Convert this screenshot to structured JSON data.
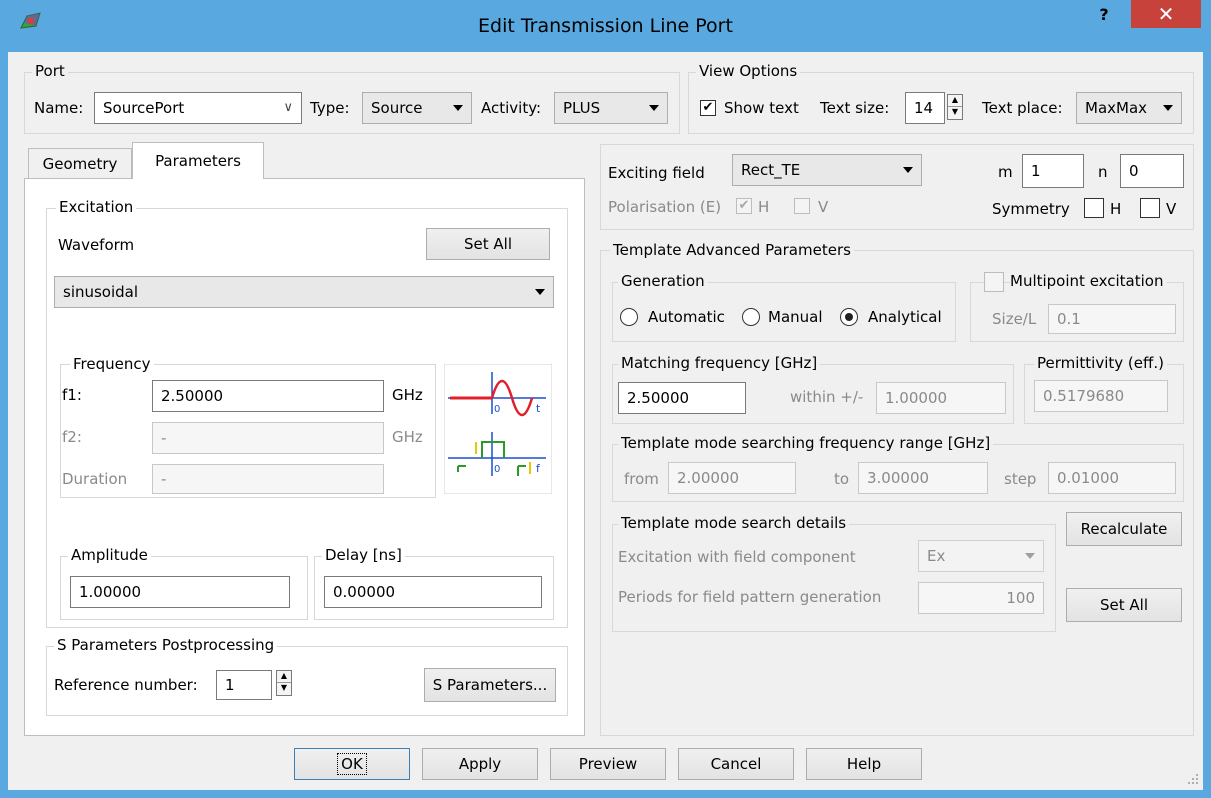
{
  "window": {
    "title": "Edit Transmission Line Port",
    "help_glyph": "?",
    "close_glyph": "✕"
  },
  "port": {
    "group_title": "Port",
    "name_label": "Name:",
    "name_value": "SourcePort",
    "type_label": "Type:",
    "type_value": "Source",
    "activity_label": "Activity:",
    "activity_value": "PLUS"
  },
  "view_options": {
    "group_title": "View Options",
    "show_text_label": "Show text",
    "show_text_checked": true,
    "text_size_label": "Text size:",
    "text_size_value": "14",
    "text_place_label": "Text place:",
    "text_place_value": "MaxMax"
  },
  "tabs": [
    {
      "label": "Geometry",
      "active": false
    },
    {
      "label": "Parameters",
      "active": true
    }
  ],
  "excitation": {
    "group_title": "Excitation",
    "waveform_label": "Waveform",
    "set_all_label": "Set All",
    "waveform_value": "sinusoidal",
    "frequency": {
      "group_title": "Frequency",
      "f1_label": "f1:",
      "f1_value": "2.50000",
      "f1_unit": "GHz",
      "f2_label": "f2:",
      "f2_value": "-",
      "f2_unit": "GHz",
      "duration_label": "Duration",
      "duration_value": "-"
    },
    "amplitude_title": "Amplitude",
    "amplitude_value": "1.00000",
    "delay_title": "Delay [ns]",
    "delay_value": "0.00000"
  },
  "sparams": {
    "group_title": "S Parameters Postprocessing",
    "ref_label": "Reference number:",
    "ref_value": "1",
    "button_label": "S Parameters..."
  },
  "field": {
    "exciting_label": "Exciting field",
    "exciting_value": "Rect_TE",
    "m_label": "m",
    "m_value": "1",
    "n_label": "n",
    "n_value": "0",
    "polarisation_label": "Polarisation (E)",
    "pol_h_label": "H",
    "pol_v_label": "V",
    "symmetry_label": "Symmetry",
    "sym_h_label": "H",
    "sym_v_label": "V"
  },
  "advanced": {
    "group_title": "Template Advanced Parameters",
    "generation": {
      "group_title": "Generation",
      "automatic": "Automatic",
      "manual": "Manual",
      "analytical": "Analytical",
      "selected": "analytical"
    },
    "multipoint": {
      "label": "Multipoint excitation",
      "size_label": "Size/L",
      "size_value": "0.1"
    },
    "matching": {
      "group_title": "Matching frequency [GHz]",
      "value": "2.50000",
      "within_label": "within +/-",
      "within_value": "1.00000"
    },
    "permittivity": {
      "group_title": "Permittivity (eff.)",
      "value": "0.5179680"
    },
    "range": {
      "group_title": "Template mode searching frequency range [GHz]",
      "from_label": "from",
      "from_value": "2.00000",
      "to_label": "to",
      "to_value": "3.00000",
      "step_label": "step",
      "step_value": "0.01000"
    },
    "details": {
      "group_title": "Template mode search details",
      "component_label": "Excitation with field component",
      "component_value": "Ex",
      "periods_label": "Periods for field pattern generation",
      "periods_value": "100"
    },
    "recalculate_label": "Recalculate",
    "set_all_label": "Set All"
  },
  "footer": {
    "ok": "OK",
    "apply": "Apply",
    "preview": "Preview",
    "cancel": "Cancel",
    "help": "Help"
  },
  "colors": {
    "titlebar": "#59a9e0",
    "close": "#c7423a",
    "wave_red": "#e0202a",
    "wave_green": "#2a9a2a",
    "wave_blue": "#1a4fd0",
    "wave_yellow": "#e8c800"
  }
}
